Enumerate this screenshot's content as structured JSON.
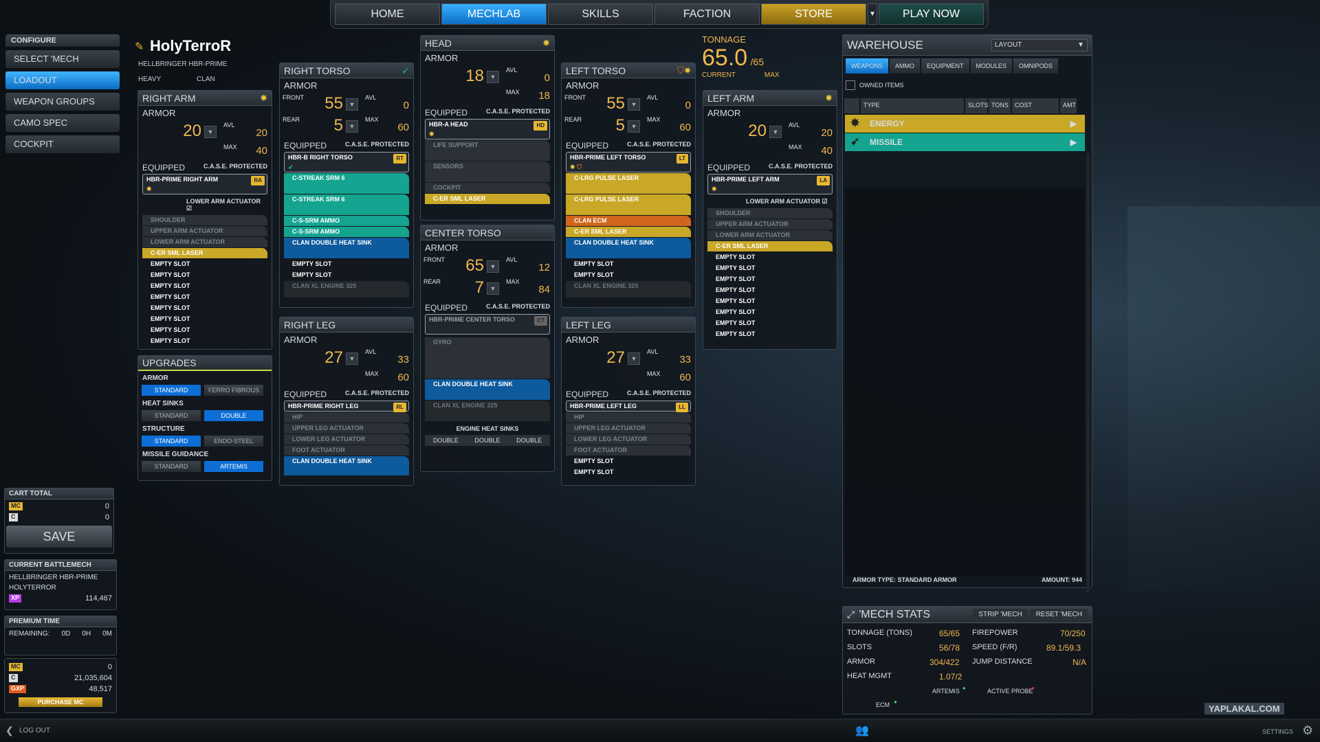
{
  "nav": {
    "tabs": [
      "HOME",
      "MECHLAB",
      "SKILLS",
      "FACTION",
      "STORE",
      "PLAY NOW"
    ]
  },
  "left": {
    "header": "CONFIGURE",
    "items": [
      "SELECT 'MECH",
      "LOADOUT",
      "WEAPON GROUPS",
      "CAMO SPEC",
      "COCKPIT"
    ],
    "cart_total": "CART TOTAL",
    "cart_mc": "0",
    "cart_cb": "0",
    "save": "SAVE",
    "current_label": "CURRENT BATTLEMECH",
    "current_mech": "HELLBRINGER HBR-PRIME",
    "current_name": "HOLYTERROR",
    "xp": "114,467",
    "premium_label": "PREMIUM TIME",
    "remaining": "REMAINING:",
    "d": "0D",
    "h": "0H",
    "m": "0M",
    "mc": "0",
    "cbills": "21,035,604",
    "gxp": "48,517",
    "purchase": "PURCHASE MC",
    "logout": "LOG OUT"
  },
  "mech": {
    "name": "HolyTerroR",
    "variant": "HELLBRINGER HBR-PRIME",
    "weight": "HEAVY",
    "tech": "CLAN"
  },
  "tonnage": {
    "label": "TONNAGE",
    "value": "65.0",
    "max": "/65",
    "current_label": "CURRENT",
    "max_label": "MAX"
  },
  "common": {
    "armor": "ARMOR",
    "avl": "AVL",
    "max": "MAX",
    "front": "FRONT",
    "rear": "REAR",
    "equipped": "EQUIPPED",
    "case": "C.A.S.E. PROTECTED",
    "empty": "EMPTY SLOT"
  },
  "right_arm": {
    "title": "RIGHT ARM",
    "armor": "20",
    "avl": "20",
    "max": "40",
    "base": "HBR-PRIME RIGHT ARM",
    "tag": "RA",
    "actuator": "LOWER ARM ACTUATOR",
    "slots": [
      "SHOULDER",
      "UPPER ARM ACTUATOR",
      "LOWER ARM ACTUATOR",
      "C-ER SML LASER",
      "EMPTY SLOT",
      "EMPTY SLOT",
      "EMPTY SLOT",
      "EMPTY SLOT",
      "EMPTY SLOT",
      "EMPTY SLOT",
      "EMPTY SLOT",
      "EMPTY SLOT"
    ]
  },
  "left_arm": {
    "title": "LEFT ARM",
    "armor": "20",
    "avl": "20",
    "max": "40",
    "base": "HBR-PRIME LEFT ARM",
    "tag": "LA",
    "actuator": "LOWER ARM ACTUATOR",
    "slots": [
      "SHOULDER",
      "UPPER ARM ACTUATOR",
      "LOWER ARM ACTUATOR",
      "C-ER SML LASER",
      "EMPTY SLOT",
      "EMPTY SLOT",
      "EMPTY SLOT",
      "EMPTY SLOT",
      "EMPTY SLOT",
      "EMPTY SLOT",
      "EMPTY SLOT",
      "EMPTY SLOT"
    ]
  },
  "right_torso": {
    "title": "RIGHT TORSO",
    "front": "55",
    "avl": "0",
    "rear": "5",
    "max": "60",
    "base": "HBR-B RIGHT TORSO",
    "tag": "RT",
    "slots": [
      "C-STREAK SRM 6",
      "C-STREAK SRM 6",
      "C-S-SRM AMMO",
      "C-S-SRM AMMO",
      "CLAN DOUBLE HEAT SINK",
      "EMPTY SLOT",
      "EMPTY SLOT",
      "CLAN XL ENGINE 325"
    ]
  },
  "left_torso": {
    "title": "LEFT TORSO",
    "front": "55",
    "avl": "0",
    "rear": "5",
    "max": "60",
    "base": "HBR-PRIME LEFT TORSO",
    "tag": "LT",
    "slots": [
      "C-LRG PULSE LASER",
      "C-LRG PULSE LASER",
      "CLAN ECM",
      "C-ER SML LASER",
      "CLAN DOUBLE HEAT SINK",
      "EMPTY SLOT",
      "EMPTY SLOT",
      "CLAN XL ENGINE 325"
    ]
  },
  "head": {
    "title": "HEAD",
    "armor": "18",
    "avl": "0",
    "max": "18",
    "base": "HBR-A HEAD",
    "tag": "HD",
    "slots": [
      "LIFE SUPPORT",
      "SENSORS",
      "COCKPIT",
      "C-ER SML LASER"
    ]
  },
  "center_torso": {
    "title": "CENTER TORSO",
    "front": "65",
    "avl": "12",
    "rear": "7",
    "max": "84",
    "base": "HBR-PRIME CENTER TORSO",
    "tag": "CT",
    "slots": [
      "GYRO",
      "CLAN DOUBLE HEAT SINK",
      "CLAN XL ENGINE 325"
    ],
    "ehs": "ENGINE HEAT SINKS",
    "double": "DOUBLE"
  },
  "right_leg": {
    "title": "RIGHT LEG",
    "armor": "27",
    "avl": "33",
    "max": "60",
    "base": "HBR-PRIME RIGHT LEG",
    "tag": "RL",
    "slots": [
      "HIP",
      "UPPER LEG ACTUATOR",
      "LOWER LEG ACTUATOR",
      "FOOT ACTUATOR",
      "CLAN DOUBLE HEAT SINK"
    ]
  },
  "left_leg": {
    "title": "LEFT LEG",
    "armor": "27",
    "avl": "33",
    "max": "60",
    "base": "HBR-PRIME LEFT LEG",
    "tag": "LL",
    "slots": [
      "HIP",
      "UPPER LEG ACTUATOR",
      "LOWER LEG ACTUATOR",
      "FOOT ACTUATOR",
      "EMPTY SLOT",
      "EMPTY SLOT"
    ]
  },
  "upgrades": {
    "title": "UPGRADES",
    "armor": "ARMOR",
    "heat": "HEAT SINKS",
    "structure": "STRUCTURE",
    "missile": "MISSILE GUIDANCE",
    "standard": "STANDARD",
    "ferro": "FERRO FIBROUS",
    "double": "DOUBLE",
    "endo": "ENDO-STEEL",
    "artemis": "ARTEMIS"
  },
  "warehouse": {
    "title": "WAREHOUSE",
    "layout": "LAYOUT",
    "tabs": [
      "WEAPONS",
      "AMMO",
      "EQUIPMENT",
      "MODULES",
      "OMNIPODS"
    ],
    "owned": "OWNED ITEMS",
    "cols": [
      "TYPE",
      "SLOTS",
      "TONS",
      "COST",
      "AMT"
    ],
    "energy": "ENERGY",
    "missile": "MISSILE",
    "armor_type": "ARMOR TYPE: STANDARD ARMOR",
    "amount": "AMOUNT: 944"
  },
  "stats": {
    "title": "'MECH STATS",
    "strip": "STRIP 'MECH",
    "reset": "RESET 'MECH",
    "tonnage_l": "TONNAGE (TONS)",
    "tonnage": "65/65",
    "slots_l": "SLOTS",
    "slots": "56/78",
    "armor_l": "ARMOR",
    "armor": "304/422",
    "heat_l": "HEAT MGMT",
    "heat": "1.07/2",
    "fire_l": "FIREPOWER",
    "fire": "70/250",
    "speed_l": "SPEED (F/R)",
    "speed": "89.1/59.3",
    "jump_l": "JUMP DISTANCE",
    "jump": "N/A",
    "artemis": "ARTEMIS",
    "probe": "ACTIVE PROBE",
    "ecm": "ECM"
  },
  "bottom": {
    "settings": "SETTINGS",
    "watermark": "YAPLAKAL.COM"
  },
  "colors": {
    "accent": "#0d6ed6",
    "gold": "#f2b84e",
    "teal": "#14a48f",
    "yellow": "#c9a727",
    "orange": "#d0661d"
  }
}
